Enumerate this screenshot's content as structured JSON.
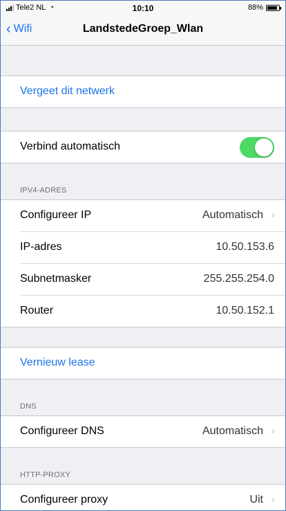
{
  "status_bar": {
    "carrier": "Tele2 NL",
    "time": "10:10",
    "battery_percent": "88%",
    "battery_level": 0.88
  },
  "nav": {
    "back_label": "Wifi",
    "title": "LandstedeGroep_Wlan"
  },
  "forget": {
    "label": "Vergeet dit netwerk"
  },
  "auto_join": {
    "label": "Verbind automatisch",
    "enabled": true
  },
  "ipv4": {
    "header": "IPV4-ADRES",
    "rows": [
      {
        "label": "Configureer IP",
        "value": "Automatisch"
      },
      {
        "label": "IP-adres",
        "value": "10.50.153.6"
      },
      {
        "label": "Subnetmasker",
        "value": "255.255.254.0"
      },
      {
        "label": "Router",
        "value": "10.50.152.1"
      }
    ]
  },
  "renew": {
    "label": "Vernieuw lease"
  },
  "dns": {
    "header": "DNS",
    "label": "Configureer DNS",
    "value": "Automatisch"
  },
  "proxy": {
    "header": "HTTP-PROXY",
    "label": "Configureer proxy",
    "value": "Uit"
  },
  "colors": {
    "accent": "#1a73e8",
    "toggle_on": "#4cd964",
    "background": "#efeff4"
  }
}
